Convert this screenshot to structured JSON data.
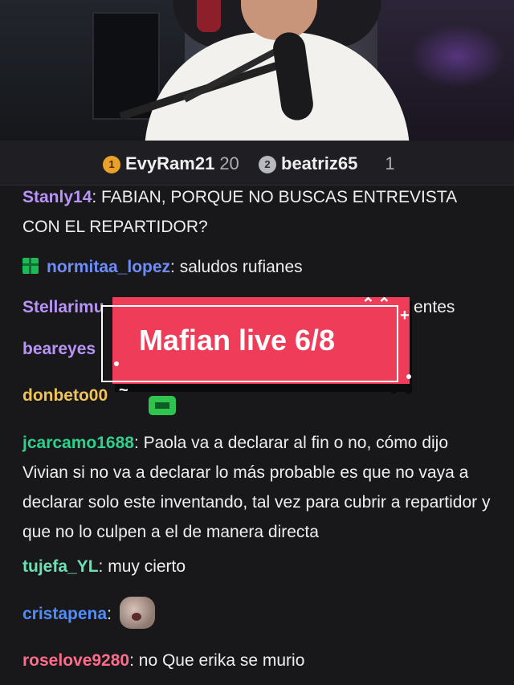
{
  "leaderboard": [
    {
      "rank": "1",
      "name": "EvyRam21",
      "count": "20"
    },
    {
      "rank": "2",
      "name": "beatriz65",
      "count": "1"
    }
  ],
  "messages": [
    {
      "user": "Stanly14",
      "user_color": "#b794f6",
      "text": ": FABIAN, PORQUE NO BUSCAS ENTREVISTA CON EL REPARTIDOR?"
    },
    {
      "user": "normitaa_lopez",
      "user_color": "#6f8df7",
      "text": ": saludos rufianes",
      "gift_icon": "gift-icon"
    },
    {
      "user": "Stellarimu",
      "user_color": "#b794f6",
      "text": "entes"
    },
    {
      "user": "beareyes",
      "user_color": "#b794f6",
      "text": ""
    },
    {
      "user": "donbeto00",
      "user_color": "#f0c35a",
      "text": ""
    },
    {
      "user": "jcarcamo1688",
      "user_color": "#2fd08c",
      "text": ": Paola va a declarar al fin o no, cómo dijo Vivian si no va a declarar lo más probable es que no vaya a declarar solo este inventando, tal vez para cubrir a repartidor y que no lo culpen a el de manera directa"
    },
    {
      "user": "tujefa_YL",
      "user_color": "#6ee0b4",
      "text": ": muy cierto"
    },
    {
      "user": "cristapena",
      "user_color": "#4f8dff",
      "text": ":",
      "sticker": "fish-face-sticker"
    },
    {
      "user": "roselove9280",
      "user_color": "#ff6b8b",
      "text": ": no Que erika se murio"
    }
  ],
  "banner": {
    "text": "Mafian live 6/8",
    "color": "#ef3c58"
  }
}
